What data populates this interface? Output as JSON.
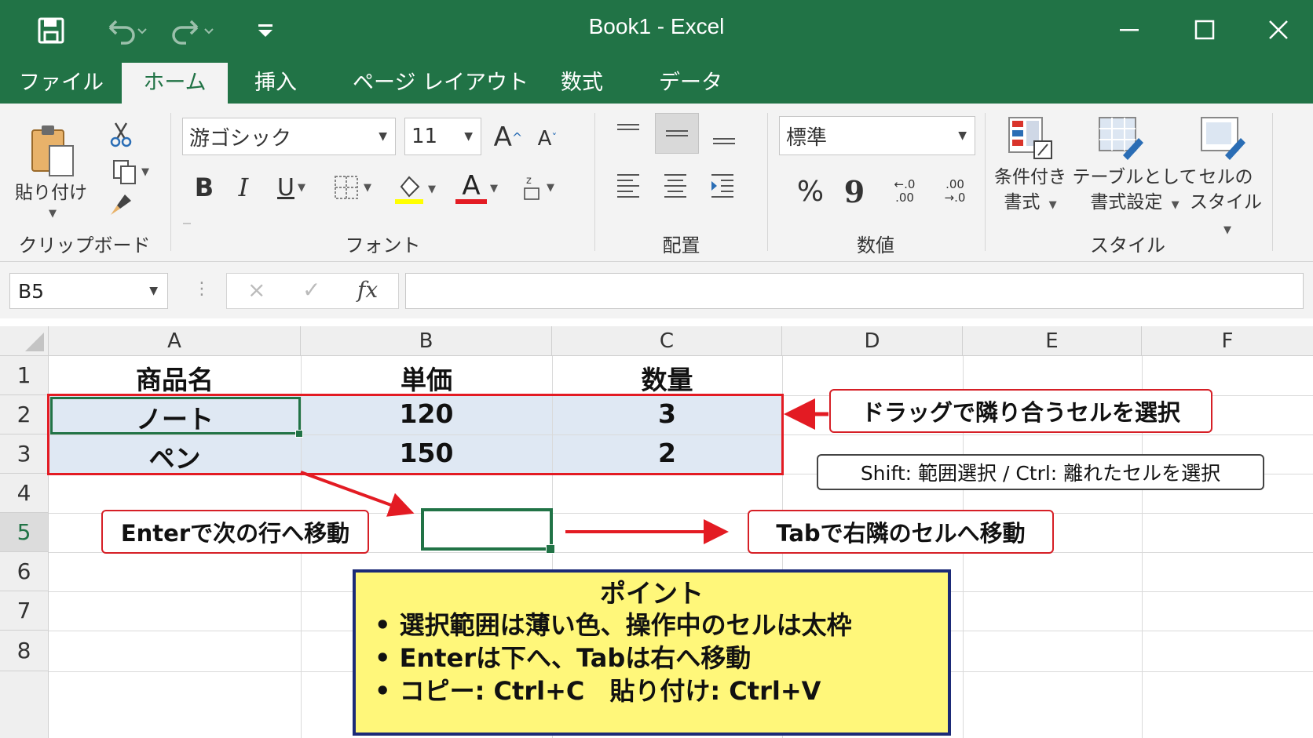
{
  "window": {
    "title": "Book1  -  Excel"
  },
  "tabs": [
    "ファイル",
    "ホーム",
    "挿入",
    "ページ レイアウト",
    "数式",
    "データ"
  ],
  "ribbon": {
    "clipboard": {
      "paste_label": "貼り付け",
      "group_label": "クリップボード"
    },
    "font": {
      "font_name": "游ゴシック",
      "font_size": "11",
      "group_label": "フォント",
      "bold": "B",
      "italic": "I",
      "underline": "U",
      "font_color_glyph": "A",
      "grow_glyph": "A",
      "shrink_glyph": "A"
    },
    "alignment": {
      "group_label": "配置"
    },
    "number": {
      "format": "標準",
      "percent": "%",
      "comma": "9",
      "inc_decimal_top": "←.0",
      "inc_decimal_bottom": ".00",
      "dec_decimal_top": ".00",
      "dec_decimal_bottom": "→.0",
      "group_label": "数値"
    },
    "styles": {
      "conditional_1": "条件付き",
      "conditional_2": "書式",
      "table_1": "テーブルとして",
      "table_2": "書式設定",
      "cell_1": "セルの",
      "cell_2": "スタイル",
      "group_label": "スタイル"
    }
  },
  "formula_bar": {
    "name_box": "B5",
    "fx": "fx",
    "cancel": "×",
    "enter": "✓"
  },
  "grid": {
    "columns": [
      "A",
      "B",
      "C",
      "D",
      "E",
      "F"
    ],
    "rows": [
      "1",
      "2",
      "3",
      "4",
      "5",
      "6",
      "7",
      "8"
    ],
    "cells": {
      "A1": "商品名",
      "B1": "単価",
      "C1": "数量",
      "A2": "ノート",
      "B2": "120",
      "C2": "3",
      "A3": "ペン",
      "B3": "150",
      "C3": "2"
    }
  },
  "annotations": {
    "drag_select": "ドラッグで隣り合うセルを選択",
    "shift_ctrl": "Shift: 範囲選択 / Ctrl: 離れたセルを選択",
    "enter_move": "Enterで次の行へ移動",
    "tab_move": "Tabで右隣のセルへ移動"
  },
  "point_box": {
    "title": "ポイント",
    "lines": [
      "• 選択範囲は薄い色、操作中のセルは太枠",
      "• Enterは下へ、Tabは右へ移動",
      "• コピー: Ctrl+C　貼り付け: Ctrl+V"
    ]
  },
  "colors": {
    "excel_green": "#217346",
    "selection_fill": "#dfe8f3",
    "annotation_red": "#d61f26",
    "point_fill": "#fff77a",
    "point_border": "#1b2a77"
  }
}
